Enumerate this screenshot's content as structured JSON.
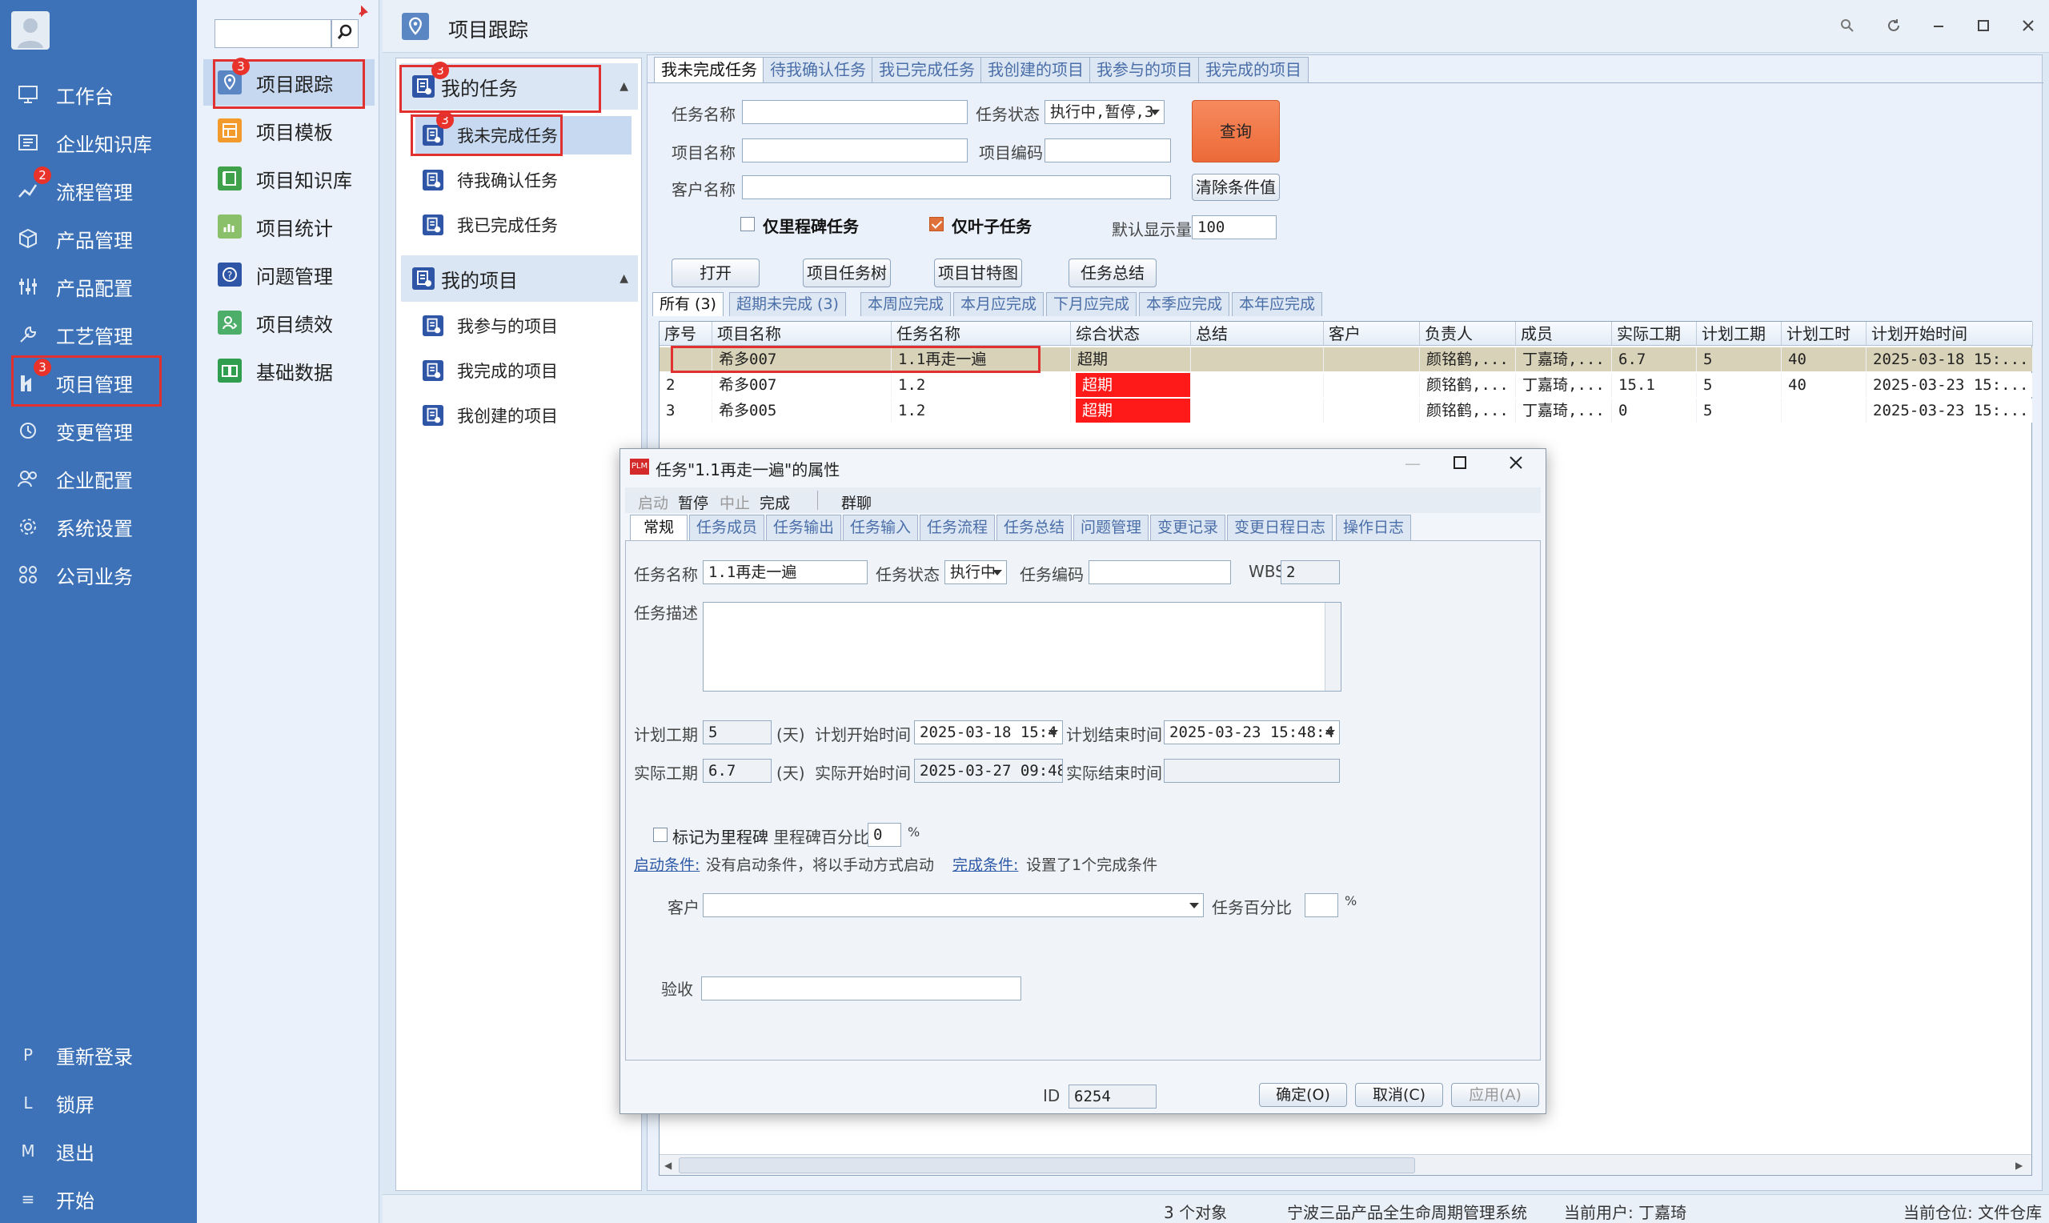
{
  "nav": {
    "items": [
      {
        "label": "工作台",
        "icon": "monitor-icon"
      },
      {
        "label": "企业知识库",
        "icon": "book-icon"
      },
      {
        "label": "流程管理",
        "icon": "flow-icon",
        "badge": "2"
      },
      {
        "label": "产品管理",
        "icon": "cube-icon"
      },
      {
        "label": "产品配置",
        "icon": "sliders-icon"
      },
      {
        "label": "工艺管理",
        "icon": "wrench-icon"
      },
      {
        "label": "项目管理",
        "icon": "project-icon",
        "badge": "3"
      },
      {
        "label": "变更管理",
        "icon": "change-icon"
      },
      {
        "label": "企业配置",
        "icon": "users-icon"
      },
      {
        "label": "系统设置",
        "icon": "gear-icon"
      },
      {
        "label": "公司业务",
        "icon": "grid-icon"
      }
    ],
    "bottom": [
      {
        "key": "P",
        "label": "重新登录"
      },
      {
        "key": "L",
        "label": "锁屏"
      },
      {
        "key": "M",
        "label": "退出"
      },
      {
        "key": "≡",
        "label": "开始"
      }
    ]
  },
  "modules": {
    "search_value": "",
    "items": [
      {
        "label": "项目跟踪",
        "badge": "3"
      },
      {
        "label": "项目模板"
      },
      {
        "label": "项目知识库"
      },
      {
        "label": "项目统计"
      },
      {
        "label": "问题管理"
      },
      {
        "label": "项目绩效"
      },
      {
        "label": "基础数据"
      }
    ]
  },
  "window": {
    "title": "项目跟踪"
  },
  "tree": {
    "group1": {
      "label": "我的任务",
      "badge": "3"
    },
    "group1_items": [
      {
        "label": "我未完成任务",
        "badge": "3"
      },
      {
        "label": "待我确认任务"
      },
      {
        "label": "我已完成任务"
      }
    ],
    "group2": {
      "label": "我的项目"
    },
    "group2_items": [
      {
        "label": "我参与的项目"
      },
      {
        "label": "我完成的项目"
      },
      {
        "label": "我创建的项目"
      }
    ]
  },
  "main": {
    "tabs": [
      "我未完成任务",
      "待我确认任务",
      "我已完成任务",
      "我创建的项目",
      "我参与的项目",
      "我完成的项目"
    ],
    "filters": {
      "task_name_label": "任务名称",
      "task_name": "",
      "task_status_label": "任务状态",
      "task_status": "执行中,暂停,3",
      "project_name_label": "项目名称",
      "project_name": "",
      "project_code_label": "项目编码",
      "project_code": "",
      "customer_label": "客户名称",
      "customer": "",
      "query": "查询",
      "clear": "清除条件值",
      "milestone_only": "仅里程碑任务",
      "leaf_only": "仅叶子任务",
      "default_count_label": "默认显示量",
      "default_count": "100"
    },
    "actions": [
      "打开",
      "项目任务树",
      "项目甘特图",
      "任务总结"
    ],
    "subtabs": [
      "所有 (3)",
      "超期未完成 (3)",
      "本周应完成",
      "本月应完成",
      "下月应完成",
      "本季应完成",
      "本年应完成"
    ],
    "columns": [
      "序号",
      "项目名称",
      "任务名称",
      "综合状态",
      "总结",
      "客户",
      "负责人",
      "成员",
      "实际工期",
      "计划工期",
      "计划工时",
      "计划开始时间"
    ],
    "rows": [
      [
        "",
        "希多007",
        "1.1再走一遍",
        "超期",
        "",
        "",
        "颜铭鹤,...",
        "丁嘉琦,...",
        "6.7",
        "5",
        "40",
        "2025-03-18 15:..."
      ],
      [
        "2",
        "希多007",
        "1.2",
        "超期",
        "",
        "",
        "颜铭鹤,...",
        "丁嘉琦,...",
        "15.1",
        "5",
        "40",
        "2025-03-23 15:..."
      ],
      [
        "3",
        "希多005",
        "1.2",
        "超期",
        "",
        "",
        "颜铭鹤,...",
        "丁嘉琦,...",
        "0",
        "5",
        "",
        "2025-03-23 15:..."
      ]
    ]
  },
  "dialog": {
    "title": "任务\"1.1再走一遍\"的属性",
    "toolbar": [
      "启动",
      "暂停",
      "中止",
      "完成",
      "群聊"
    ],
    "tabs": [
      "常规",
      "任务成员",
      "任务输出",
      "任务输入",
      "任务流程",
      "任务总结",
      "问题管理",
      "变更记录",
      "变更日程日志",
      "操作日志"
    ],
    "task_name_label": "任务名称",
    "task_name": "1.1再走一遍",
    "task_status_label": "任务状态",
    "task_status": "执行中",
    "task_code_label": "任务编码",
    "task_code": "",
    "wbs_label": "WBS",
    "wbs": "2",
    "desc_label": "任务描述",
    "plan_days_label": "计划工期",
    "plan_days": "5",
    "unit_days": "(天)",
    "plan_start_label": "计划开始时间",
    "plan_start": "2025-03-18 15:4",
    "plan_end_label": "计划结束时间",
    "plan_end": "2025-03-23 15:48:4",
    "actual_days_label": "实际工期",
    "actual_days": "6.7",
    "actual_start_label": "实际开始时间",
    "actual_start": "2025-03-27 09:48:",
    "actual_end_label": "实际结束时间",
    "actual_end": "",
    "milestone_label": "标记为里程碑",
    "milestone_pct_label": "里程碑百分比",
    "milestone_pct": "0",
    "pct_sign": "%",
    "start_cond_link": "启动条件:",
    "start_cond_text": "没有启动条件，将以手动方式启动",
    "finish_cond_link": "完成条件:",
    "finish_cond_text": "设置了1个完成条件",
    "customer_label": "客户",
    "customer": "",
    "task_pct_label": "任务百分比",
    "task_pct": "",
    "accept_label": "验收",
    "accept": "",
    "id_label": "ID",
    "id": "6254",
    "ok": "确定(O)",
    "cancel": "取消(C)",
    "apply": "应用(A)"
  },
  "status": {
    "count": "3 个对象",
    "system": "宁波三品产品全生命周期管理系统",
    "user": "当前用户: 丁嘉琦",
    "location": "当前仓位: 文件仓库"
  },
  "colors": {
    "nav_bg": "#3d72b8",
    "overdue_red": "#ff1a1a",
    "query_orange": "#f0784a",
    "highlight_row": "#d8d2b8"
  }
}
